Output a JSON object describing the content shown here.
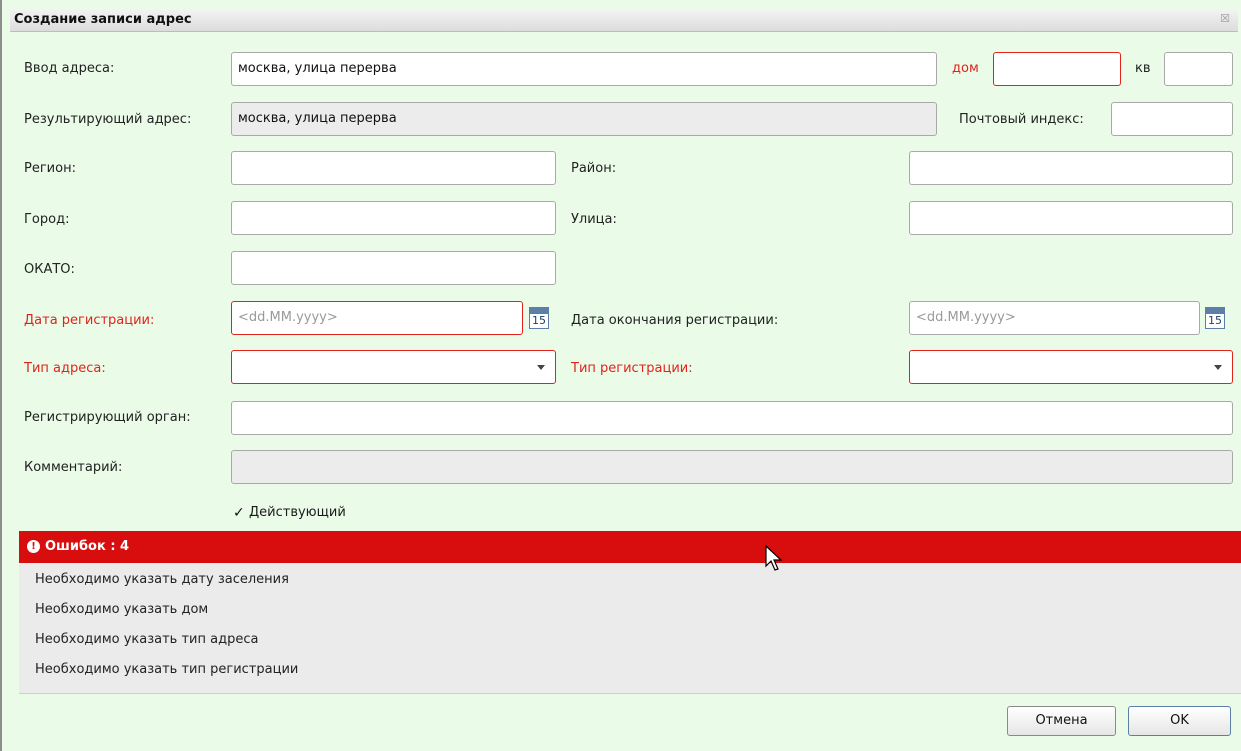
{
  "window": {
    "title": "Создание записи адрес",
    "close_symbol": "☒"
  },
  "form": {
    "address_input": {
      "label": "Ввод адреса:",
      "value": "москва, улица перерва"
    },
    "house": {
      "label": "дом",
      "value": ""
    },
    "apartment": {
      "label": "кв",
      "value": ""
    },
    "result_address": {
      "label": "Результирующий адрес:",
      "value": "москва, улица перерва"
    },
    "postal_index": {
      "label": "Почтовый индекс:",
      "value": ""
    },
    "region": {
      "label": "Регион:",
      "value": ""
    },
    "district": {
      "label": "Район:",
      "value": ""
    },
    "city": {
      "label": "Город:",
      "value": ""
    },
    "street": {
      "label": "Улица:",
      "value": ""
    },
    "okato": {
      "label": "ОКАТО:",
      "value": ""
    },
    "reg_date": {
      "label": "Дата регистрации:",
      "placeholder": "<dd.MM.yyyy>",
      "calendar_day": "15"
    },
    "reg_end_date": {
      "label": "Дата окончания регистрации:",
      "placeholder": "<dd.MM.yyyy>",
      "calendar_day": "15"
    },
    "address_type": {
      "label": "Тип адреса:",
      "value": ""
    },
    "reg_type": {
      "label": "Тип регистрации:",
      "value": ""
    },
    "reg_authority": {
      "label": "Регистрирующий орган:",
      "value": ""
    },
    "comment": {
      "label": "Комментарий:",
      "value": ""
    },
    "active": {
      "label": "Действующий",
      "checked": true,
      "check_symbol": "✓"
    }
  },
  "errors": {
    "header": "Ошибок : 4",
    "icon_symbol": "!",
    "items": [
      "Необходимо указать дату заселения",
      "Необходимо указать дом",
      "Необходимо указать тип адреса",
      "Необходимо указать тип регистрации"
    ]
  },
  "buttons": {
    "cancel": "Отмена",
    "ok": "OK"
  },
  "colors": {
    "background": "#eafbe8",
    "error_red": "#d80e0e",
    "required_label": "#e0241b"
  }
}
